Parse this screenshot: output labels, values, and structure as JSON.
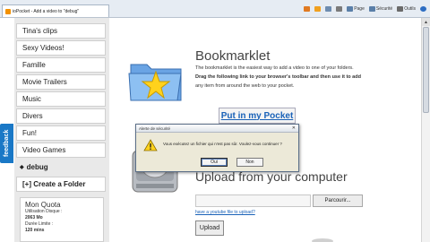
{
  "browser": {
    "tab_title": "ioPocket - Add a video to \"debug\"",
    "commands": [
      {
        "label": "",
        "icon": "home-icon",
        "color": "#e07a22"
      },
      {
        "label": "",
        "icon": "feeds-icon",
        "color": "#f0a020"
      },
      {
        "label": "",
        "icon": "mail-icon",
        "color": "#6d8cb0"
      },
      {
        "label": "",
        "icon": "print-icon",
        "color": "#7a7a7a"
      },
      {
        "label": "Page",
        "icon": "page-icon",
        "color": "#5a7fa8"
      },
      {
        "label": "Sécurité",
        "icon": "security-icon",
        "color": "#5a7fa8"
      },
      {
        "label": "Outils",
        "icon": "tools-icon",
        "color": "#6a6a6a"
      },
      {
        "label": "",
        "icon": "help-icon",
        "color": "#2d6dc2"
      }
    ]
  },
  "sidebar": {
    "items": [
      {
        "label": "Tina's clips"
      },
      {
        "label": "Sexy Videos!"
      },
      {
        "label": "Famille"
      },
      {
        "label": "Movie Trailers"
      },
      {
        "label": "Music"
      },
      {
        "label": "Divers"
      },
      {
        "label": "Fun!"
      },
      {
        "label": "Video Games"
      },
      {
        "label": "debug",
        "active": true
      },
      {
        "label": "[+] Create a Folder",
        "create": true
      }
    ],
    "quota": {
      "title": "Mon Quota",
      "lines": [
        "Utilisation Disque :",
        "2063 Mo",
        "Durée Limite :",
        "120 mins"
      ]
    },
    "feedback_label": "feedback"
  },
  "bookmarklet": {
    "title": "Bookmarklet",
    "line1": "The bookmarklet is the easiest way to add a video to one of your folders.",
    "line2": "Drag the following link to your browser's toolbar and then use it to add",
    "line3": "any item from around the web to your pocket.",
    "button_label": "Put in my Pocket"
  },
  "upload": {
    "title": "Upload from your computer",
    "browse_label": "Parcourir...",
    "youtube_link": "have a youtube file to upload?",
    "upload_button": "Upload"
  },
  "dialog": {
    "title": "Alerte de sécurité",
    "message": "Vous exécutez un fichier qui n'est pas sûr. Voulez-vous continuer ?",
    "ok_label": "Oui",
    "cancel_label": "Non"
  },
  "colors": {
    "accent_link": "#1a62b8",
    "feedback_tab": "#1a78c6",
    "sidebar_bg": "#e9e9e9"
  }
}
